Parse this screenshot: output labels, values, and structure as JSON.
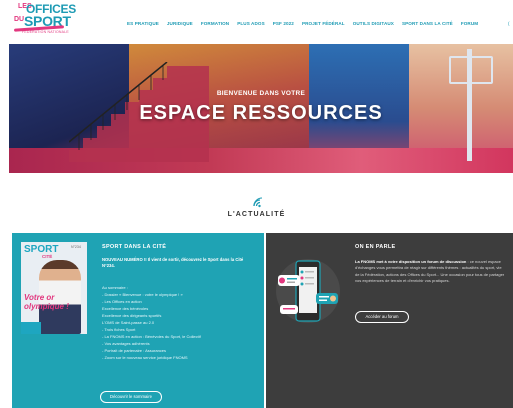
{
  "logo": {
    "line1": "LES",
    "line2": "OFFICES",
    "line3": "DU",
    "line4": "SPORT",
    "tagline": "FÉDÉRATION NATIONALE"
  },
  "nav": {
    "items": [
      "ES PRATIQUE",
      "JURIDIQUE",
      "FORMATION",
      "PLUS ADOS",
      "PSF 2022",
      "PROJET FÉDÉRAL",
      "OUTILS DIGITAUX",
      "SPORT DANS LA CITÉ",
      "FORUM"
    ],
    "trailing": "("
  },
  "hero": {
    "subtitle": "BIENVENUE DANS VOTRE",
    "title": "ESPACE RESSOURCES"
  },
  "actualite": {
    "icon": "wifi-signal-icon",
    "title": "L'ACTUALITÉ"
  },
  "left_panel": {
    "heading": "SPORT DANS LA CITÉ",
    "intro": "NOUVEAU NUMÉRO !! Il vient de sortir, découvrez le Sport dans la Cité N°234.",
    "list": [
      "Au sommaire :",
      "- Dossier « Bienvenue : votre le olympique ! »",
      "- Les Offices en action",
      "Excellence des bénévoles",
      "Excellence des dirigeants sportifs",
      "L'OMS de Saint-passe au 2.0",
      "- Trois fiches Sport",
      "- La FNOMS en action : Bénévoles du Sport, le Collectif",
      "- Vos avantages adhérents",
      "- Portrait de partenaire : Assurances",
      "- Zoom sur le nouveau service juridique FNOMS"
    ],
    "button": "Découvrir le sommaire",
    "magazine": {
      "brand": "SPORT",
      "brand_sub": "CITÉ",
      "issue": "N°234",
      "headline": "Votre or olympique !"
    }
  },
  "right_panel": {
    "heading": "ON EN PARLE",
    "text_bold": "La FNOMS met à votre disposition un forum de discussion",
    "text": ": ce nouvel espace d'échanges vous permettra de réagir sur différents thèmes : actualités du sport, vie de la Fédération, actions des Offices du Sport... Une occasion pour tous de partager vos expériences de terrain et d'enrichir vos pratiques.",
    "button": "Accéder au forum",
    "illustration_icon": "forum-chat-icon"
  },
  "colors": {
    "brand_blue": "#1e9bb4",
    "brand_pink": "#e2387f",
    "panel_teal": "#1fa3b4",
    "panel_dark": "#3d3d3d"
  }
}
